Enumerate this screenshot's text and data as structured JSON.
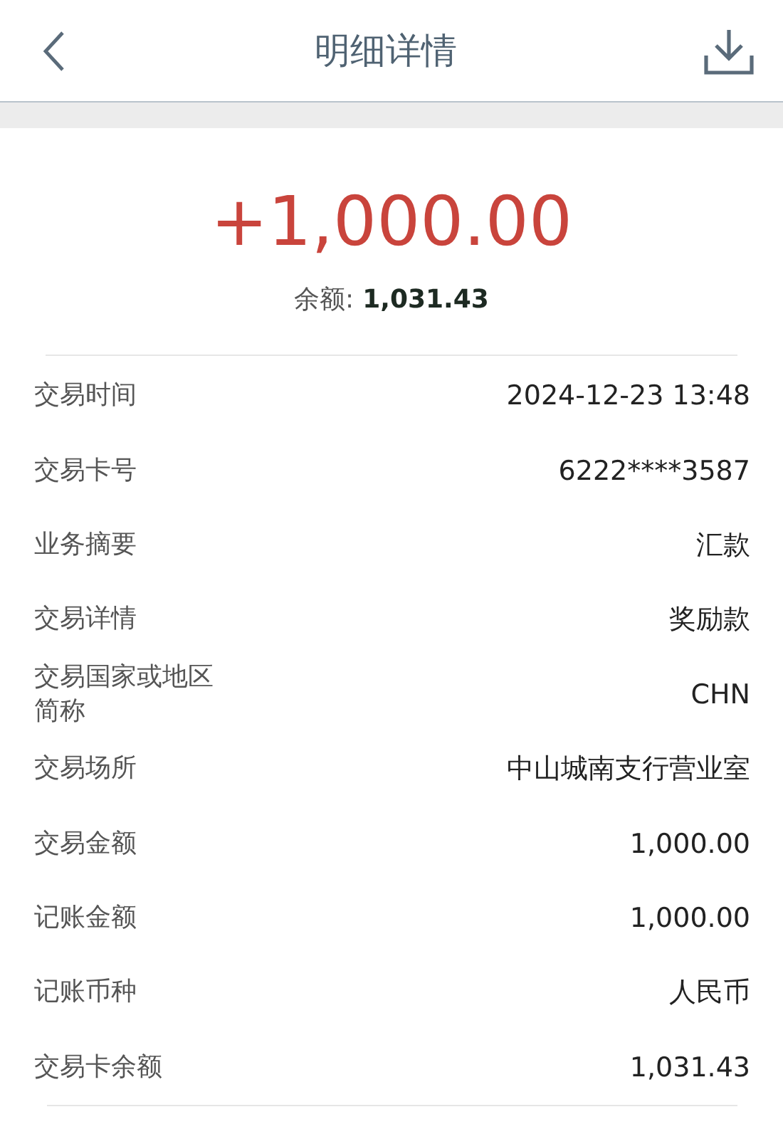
{
  "header": {
    "title": "明细详情"
  },
  "summary": {
    "amount": "+1,000.00",
    "balance_label": "余额:",
    "balance_value": "1,031.43"
  },
  "details": [
    {
      "label": "交易时间",
      "value": "2024-12-23 13:48"
    },
    {
      "label": "交易卡号",
      "value": "6222****3587"
    },
    {
      "label": "业务摘要",
      "value": "汇款"
    },
    {
      "label": "交易详情",
      "value": "奖励款"
    },
    {
      "label": "交易国家或地区简称",
      "value": "CHN"
    },
    {
      "label": "交易场所",
      "value": "中山城南支行营业室"
    },
    {
      "label": "交易金额",
      "value": "1,000.00"
    },
    {
      "label": "记账金额",
      "value": "1,000.00"
    },
    {
      "label": "记账币种",
      "value": "人民币"
    },
    {
      "label": "交易卡余额",
      "value": "1,031.43"
    }
  ]
}
